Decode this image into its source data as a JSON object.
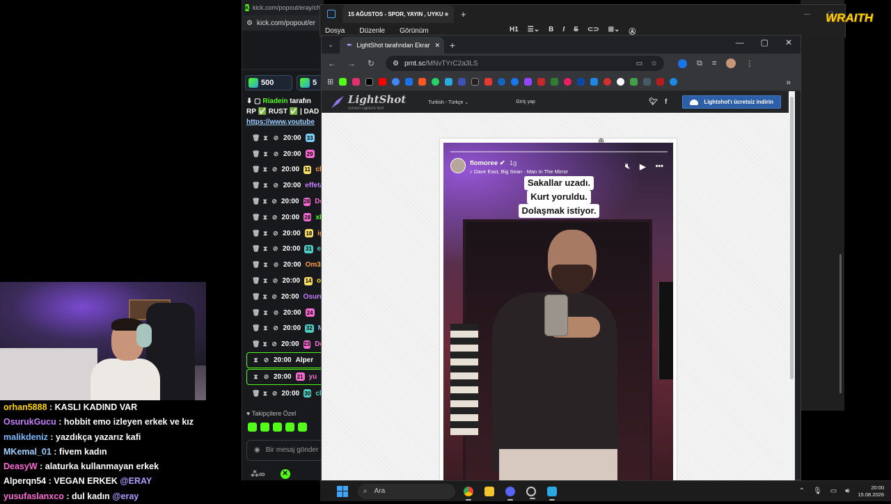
{
  "stream_chat": [
    {
      "user": "orhan5888",
      "color": "#ffd700",
      "text": "KASLI KADIND VAR",
      "mention": ""
    },
    {
      "user": "OsurukGucu",
      "color": "#c77dff",
      "text": "hobbit emo izleyen erkek ve kız",
      "mention": ""
    },
    {
      "user": "malikdeniz",
      "color": "#7ab8ff",
      "text": "yazdıkça yazarız kafi",
      "mention": ""
    },
    {
      "user": "MKemal_01",
      "color": "#9fd0ff",
      "text": "fivem kadın",
      "mention": ""
    },
    {
      "user": "DeasyW",
      "color": "#ff6bd5",
      "text": "alaturka kullanmayan erkek",
      "mention": ""
    },
    {
      "user": "Alperqn54",
      "color": "#ffffff",
      "text": "VEGAN ERKEK",
      "mention": "@ERAY"
    },
    {
      "user": "yusufaslanxco",
      "color": "#ff6bd5",
      "text": "dul kadın",
      "mention": "@eray"
    }
  ],
  "kick": {
    "title_url": "kick.com/popout/eray/cha",
    "address": "kick.com/popout/er",
    "points": [
      "500",
      "5"
    ],
    "pinned": {
      "author": "Riadein",
      "author_suffix": "tarafın",
      "line2": "RP ✅ RUST ✅ | DAD",
      "link": "https://www.youtube"
    },
    "rows": [
      {
        "time": "20:00",
        "lvl": "33",
        "lvl_color": "#7bd3ff",
        "name": "",
        "name_color": "#ffd700",
        "hl": false
      },
      {
        "time": "20:00",
        "lvl": "29",
        "lvl_color": "#ff6bd5",
        "name": "",
        "name_color": "#ff6bd5",
        "hl": false
      },
      {
        "time": "20:00",
        "lvl": "11",
        "lvl_color": "#ffe066",
        "name": "ch",
        "name_color": "#ff9f43",
        "hl": false
      },
      {
        "time": "20:00",
        "lvl": "",
        "lvl_color": "",
        "name": "effeta",
        "name_color": "#c77dff",
        "hl": false
      },
      {
        "time": "20:00",
        "lvl": "28",
        "lvl_color": "#ff6bd5",
        "name": "De",
        "name_color": "#ff6bd5",
        "hl": false
      },
      {
        "time": "20:00",
        "lvl": "28",
        "lvl_color": "#ff6bd5",
        "name": "xF",
        "name_color": "#53fc18",
        "hl": false
      },
      {
        "time": "20:00",
        "lvl": "18",
        "lvl_color": "#ffe066",
        "name": "ig",
        "name_color": "#ff9f43",
        "hl": false
      },
      {
        "time": "20:00",
        "lvl": "31",
        "lvl_color": "#4ecdc4",
        "name": "er",
        "name_color": "#4ecdc4",
        "hl": false
      },
      {
        "time": "20:00",
        "lvl": "",
        "lvl_color": "",
        "name": "Om3r",
        "name_color": "#ff9f43",
        "hl": false
      },
      {
        "time": "20:00",
        "lvl": "14",
        "lvl_color": "#ffe066",
        "name": "or",
        "name_color": "#ffd700",
        "hl": false
      },
      {
        "time": "20:00",
        "lvl": "",
        "lvl_color": "",
        "name": "Osuru",
        "name_color": "#c77dff",
        "hl": false
      },
      {
        "time": "20:00",
        "lvl": "24",
        "lvl_color": "#ff6bd5",
        "name": "",
        "name_color": "#ff6bd5",
        "hl": false
      },
      {
        "time": "20:00",
        "lvl": "32",
        "lvl_color": "#4ecdc4",
        "name": "M",
        "name_color": "#7ab8ff",
        "hl": false
      },
      {
        "time": "20:00",
        "lvl": "23",
        "lvl_color": "#ff6bd5",
        "name": "De",
        "name_color": "#ff6bd5",
        "hl": false
      },
      {
        "time": "20:00",
        "lvl": "",
        "lvl_color": "",
        "name": "Alper",
        "name_color": "#ffffff",
        "hl": true
      },
      {
        "time": "20:00",
        "lvl": "21",
        "lvl_color": "#ff6bd5",
        "name": "yu",
        "name_color": "#ff6bd5",
        "hl": true
      },
      {
        "time": "20:00",
        "lvl": "30",
        "lvl_color": "#4ecdc4",
        "name": "ch",
        "name_color": "#4ecdc4",
        "hl": false
      }
    ],
    "follow_label": "Takipçilere Özel",
    "input_placeholder": "Bir mesaj gönder"
  },
  "notes": {
    "tab_title": "15 AĞUSTOS - SPOR, YAYIN , UYKU",
    "menu": [
      "Dosya",
      "Düzenle",
      "Görünüm"
    ],
    "heading_btn": "H1"
  },
  "browser": {
    "tab_title": "LightShot tarafından Ekran Görü",
    "url_host": "prnt.sc",
    "url_path": "/MNvTYrC2a3LS"
  },
  "lightshot": {
    "brand": "LightShot",
    "tagline": "screen capture tool",
    "language": "Turkish - Türkçe",
    "login": "Giriş yap",
    "download": "Lightshot'ı ücretsiz indirin"
  },
  "story": {
    "username": "flomoree",
    "age": "1g",
    "music": "Dave East, Big Sean · Man In The Mirror",
    "caption": [
      "Sakallar uzadı.",
      "Kurt yoruldu.",
      "Dolaşmak istiyor."
    ]
  },
  "watermark": "WRAITH",
  "taskbar": {
    "search_placeholder": "Ara",
    "time": "20:00",
    "date": "15.08.2026",
    "badge_count": "25"
  }
}
